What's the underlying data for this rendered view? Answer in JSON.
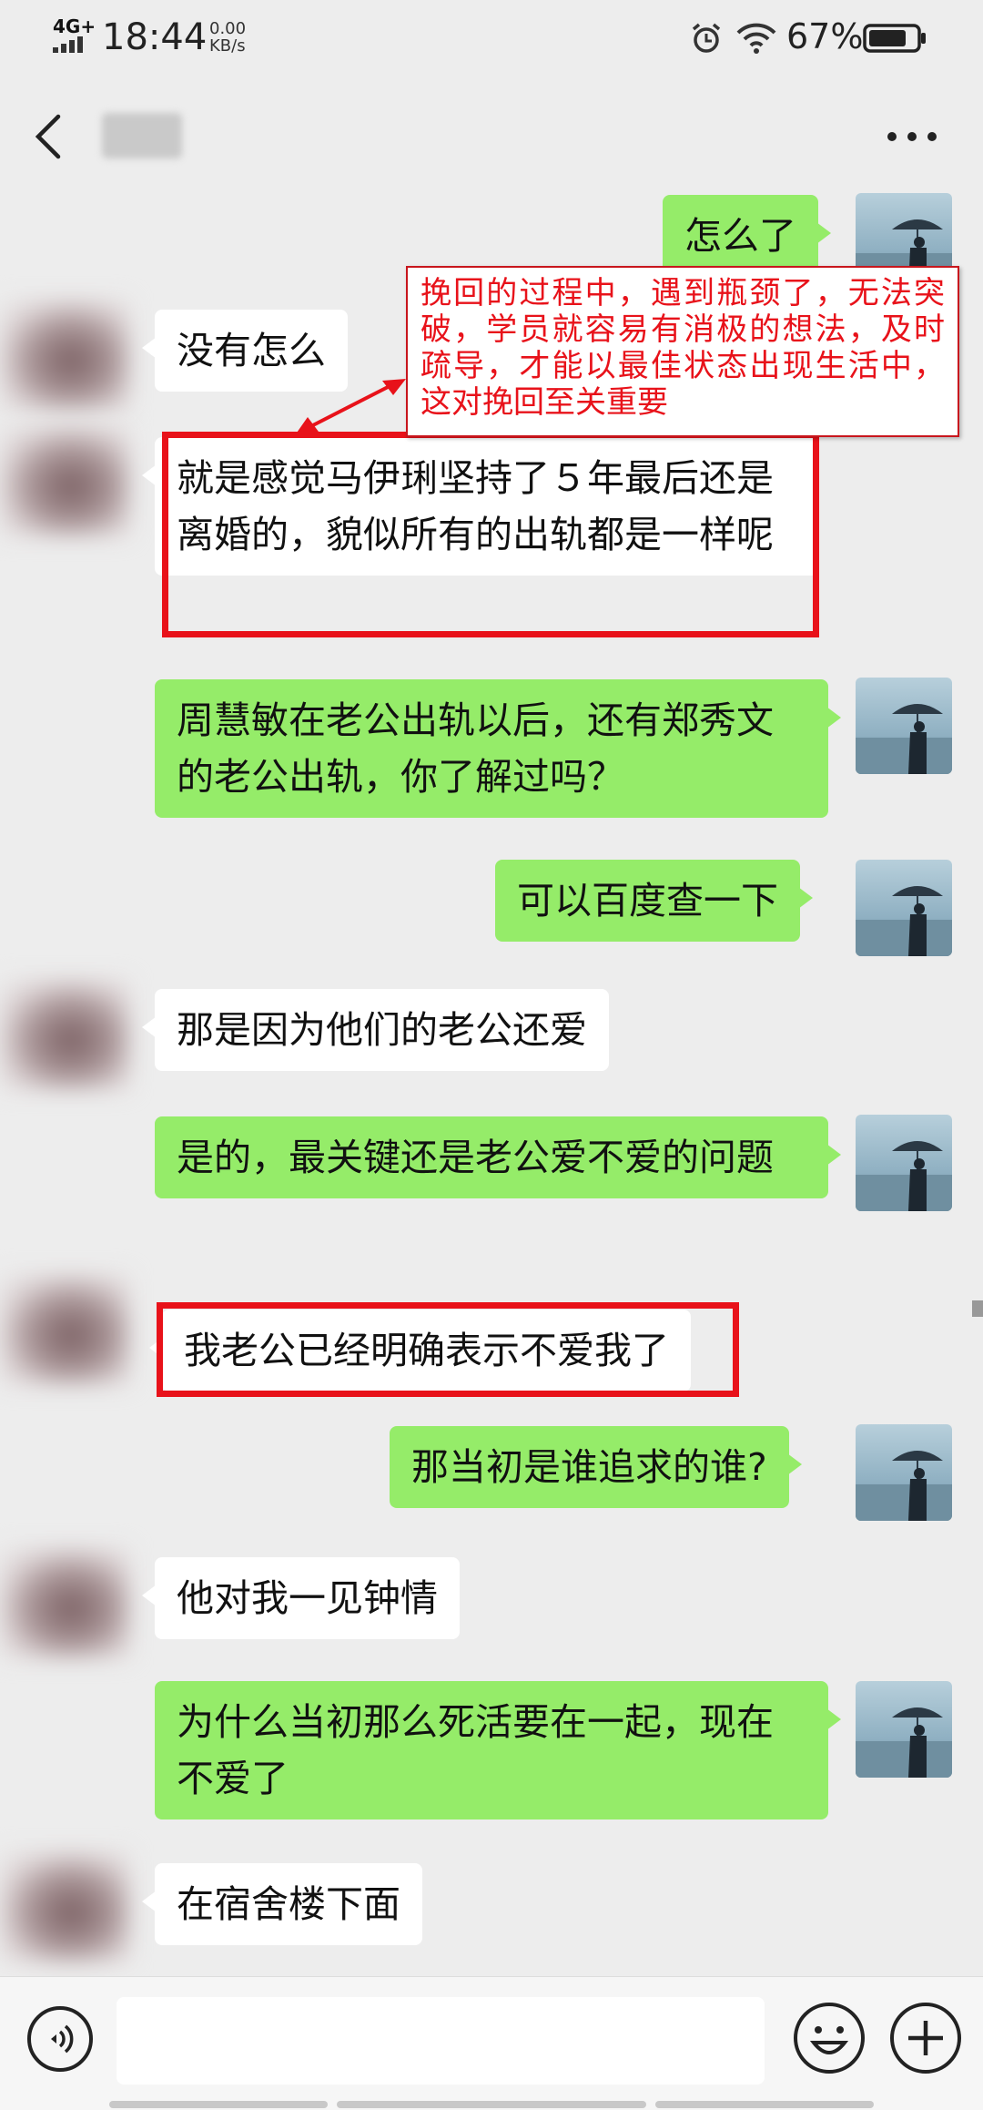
{
  "status_bar": {
    "network": "4G+",
    "time": "18:44",
    "speed_value": "0.00",
    "speed_unit": "KB/s",
    "battery": "67%"
  },
  "header": {
    "back_icon": "chevron-left-icon",
    "more_icon": "more-dots-icon"
  },
  "messages": [
    {
      "side": "me",
      "text": "怎么了"
    },
    {
      "side": "other",
      "text": "没有怎么"
    },
    {
      "side": "other",
      "text": "就是感觉马伊琍坚持了５年最后还是离婚的，貌似所有的出轨都是一样呢",
      "highlighted": true
    },
    {
      "side": "me",
      "text": "周慧敏在老公出轨以后，还有郑秀文的老公出轨，你了解过吗？"
    },
    {
      "side": "me",
      "text": "可以百度查一下"
    },
    {
      "side": "other",
      "text": "那是因为他们的老公还爱"
    },
    {
      "side": "me",
      "text": "是的，最关键还是老公爱不爱的问题"
    },
    {
      "side": "other",
      "text": "我老公已经明确表示不爱我了",
      "highlighted": true
    },
    {
      "side": "me",
      "text": "那当初是谁追求的谁?"
    },
    {
      "side": "other",
      "text": "他对我一见钟情"
    },
    {
      "side": "me",
      "text": "为什么当初那么死活要在一起，现在不爱了"
    },
    {
      "side": "other",
      "text": "在宿舍楼下面"
    }
  ],
  "annotation": {
    "text": "挽回的过程中，遇到瓶颈了，无法突破，学员就容易有消极的想法，及时疏导，才能以最佳状态出现生活中，这对挽回至关重要",
    "color": "#e8121a"
  },
  "input_bar": {
    "voice_icon": "voice-icon",
    "emoji_icon": "emoji-icon",
    "plus_icon": "plus-icon"
  },
  "colors": {
    "background": "#ededed",
    "my_bubble": "#95ec69",
    "other_bubble": "#ffffff",
    "highlight_box": "#e8121a"
  }
}
